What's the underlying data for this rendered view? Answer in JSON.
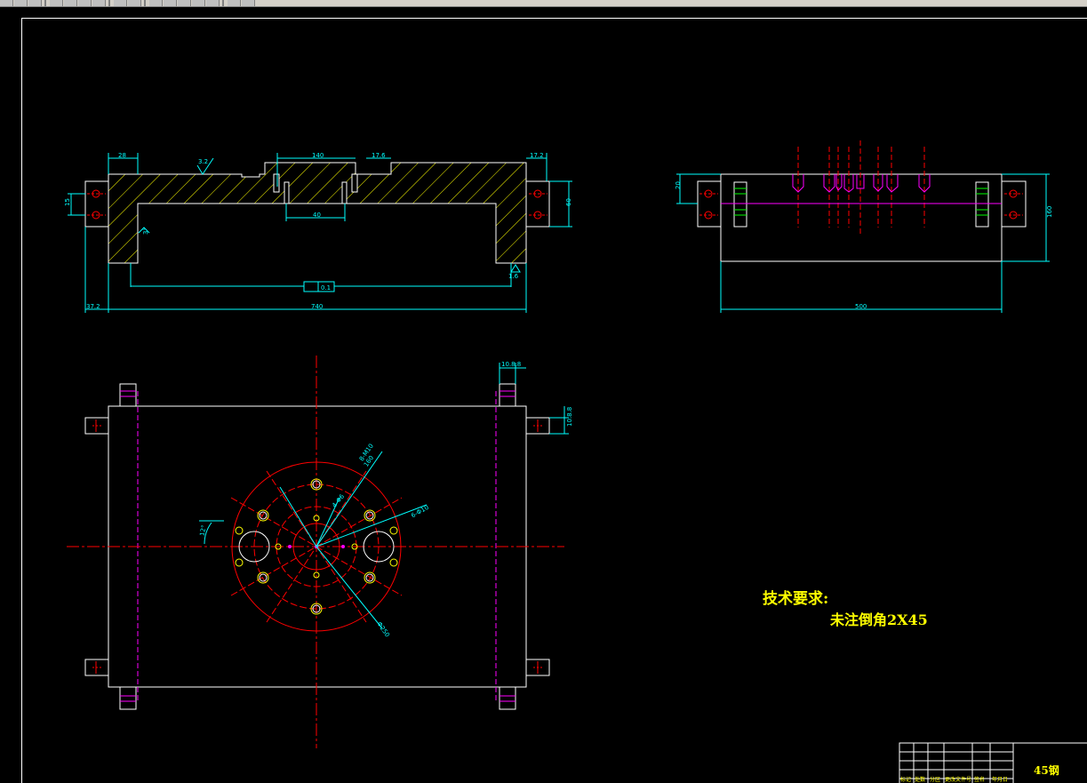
{
  "toolbar": {
    "icons": [
      "new-icon",
      "open-icon",
      "save-icon",
      "print-icon",
      "cut-icon",
      "copy-icon",
      "paste-icon",
      "undo-icon",
      "redo-icon",
      "pan-icon",
      "zoom-realtime-icon",
      "zoom-window-icon",
      "zoom-previous-icon",
      "properties-icon",
      "design-center-icon",
      "help-icon"
    ]
  },
  "colors": {
    "background": "#000000",
    "outline": "#ffffff",
    "dimension": "#00ffff",
    "centerline": "#ff0000",
    "hatch": "#ffff00",
    "hidden": "#ff00ff",
    "text": "#ffff00"
  },
  "front_view": {
    "dims": {
      "top_left": "28",
      "top_mid": "140",
      "top_right_small": "17.6",
      "top_right": "17.2",
      "roughness": "3.2",
      "left_height": "15",
      "right_height": "60",
      "inner": "40",
      "bottom_left": "37.2",
      "bottom_total": "740",
      "tolerance": "0.1",
      "roughness_right": "1.6",
      "angle_note": "3°"
    }
  },
  "side_view": {
    "dims": {
      "left_small": "20",
      "height": "160",
      "width": "500"
    }
  },
  "top_view": {
    "dims": {
      "top_right": "10.8.8",
      "right_side": "10.8.8",
      "angle": "12°",
      "hole_pattern_1": "8-M10",
      "hole_pattern_2": "160",
      "hole_small": "4-Φ6",
      "hole_right": "6-Φ10",
      "circle_dia": "Φ250"
    }
  },
  "tech_requirements": {
    "title": "技术要求:",
    "note": "未注倒角2X45"
  },
  "title_block": {
    "material": "45钢",
    "labels": [
      "标记",
      "处数",
      "分区",
      "更改文件号",
      "签名",
      "年月日"
    ]
  }
}
